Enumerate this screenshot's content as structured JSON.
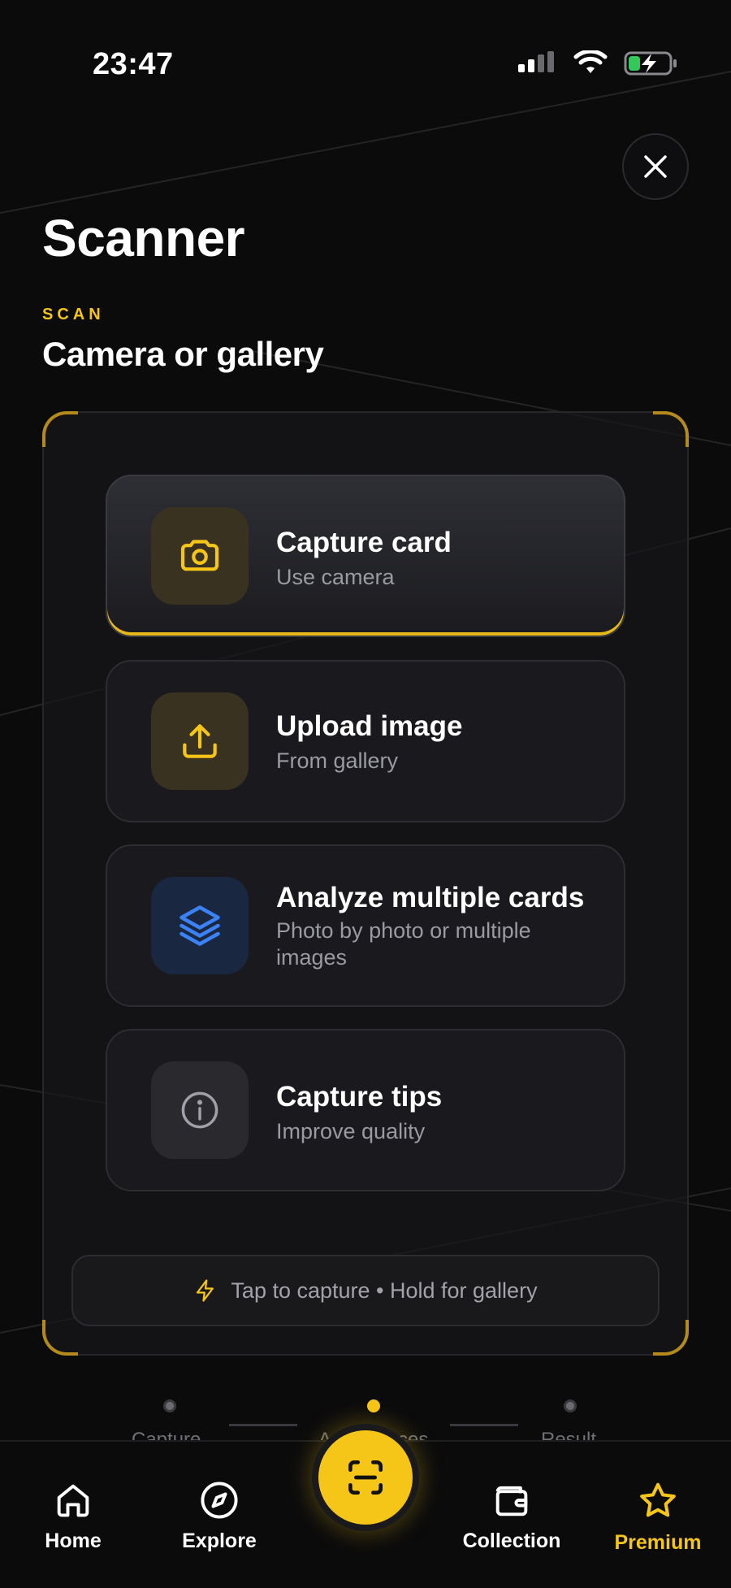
{
  "status_bar": {
    "time": "23:47"
  },
  "header": {
    "title": "Scanner",
    "eyebrow": "SCAN",
    "subtitle": "Camera or gallery"
  },
  "options": [
    {
      "title": "Capture card",
      "subtitle": "Use camera",
      "icon": "camera-icon"
    },
    {
      "title": "Upload image",
      "subtitle": "From gallery",
      "icon": "upload-icon"
    },
    {
      "title": "Analyze multiple cards",
      "subtitle": "Photo by photo or multiple images",
      "icon": "layers-icon"
    },
    {
      "title": "Capture tips",
      "subtitle": "Improve quality",
      "icon": "info-icon"
    }
  ],
  "hint": "Tap to capture • Hold for gallery",
  "stepper": {
    "steps": [
      "Capture",
      "Analyze",
      "Result"
    ],
    "visible_labels": [
      "Capture",
      "A",
      "ces",
      "Result"
    ]
  },
  "tabbar": {
    "home": "Home",
    "explore": "Explore",
    "collection": "Collection",
    "premium": "Premium"
  },
  "colors": {
    "accent": "#f5c518",
    "background": "#0b0b0c",
    "blue_accent": "#3b82f6"
  }
}
